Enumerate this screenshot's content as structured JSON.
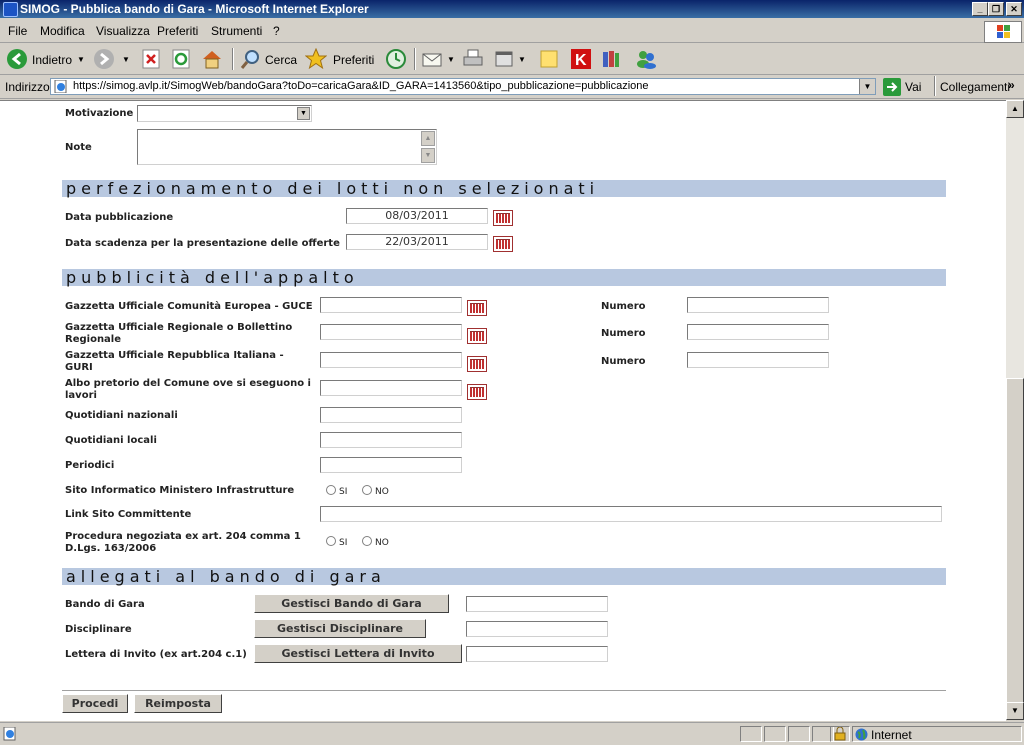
{
  "window": {
    "title": "SIMOG - Pubblica bando di Gara - Microsoft Internet Explorer"
  },
  "menu": {
    "file": "File",
    "modifica": "Modifica",
    "visualizza": "Visualizza",
    "preferiti": "Preferiti",
    "strumenti": "Strumenti",
    "help": "?"
  },
  "toolbar": {
    "back_label": "Indietro",
    "search_label": "Cerca",
    "favorites_label": "Preferiti"
  },
  "address": {
    "label": "Indirizzo",
    "url": "https://simog.avlp.it/SimogWeb/bandoGara?toDo=caricaGara&ID_GARA=1413560&tipo_pubblicazione=pubblicazione",
    "go_label": "Vai",
    "links_label": "Collegamenti"
  },
  "form": {
    "motivazione_label": "Motivazione",
    "note_label": "Note",
    "section1": "perfezionamento dei lotti non selezionati",
    "data_pubblicazione_label": "Data pubblicazione",
    "data_pubblicazione_value": "08/03/2011",
    "data_scadenza_label": "Data scadenza per la presentazione delle offerte",
    "data_scadenza_value": "22/03/2011",
    "section2": "pubblicità dell'appalto",
    "guce_label": "Gazzetta Ufficiale Comunità Europea - GUCE",
    "gur_label": "Gazzetta Ufficiale Regionale o Bollettino Regionale",
    "guri_label": "Gazzetta Ufficiale Repubblica Italiana - GURI",
    "albo_label": "Albo pretorio del Comune ove si eseguono i lavori",
    "numero_label": "Numero",
    "quotidiani_nazionali_label": "Quotidiani nazionali",
    "quotidiani_locali_label": "Quotidiani locali",
    "periodici_label": "Periodici",
    "sito_label": "Sito Informatico Ministero Infrastrutture",
    "si_label": "SI",
    "no_label": "NO",
    "link_label": "Link Sito Committente",
    "procedura_label": "Procedura negoziata ex art. 204 comma 1 D.Lgs. 163/2006",
    "section3": "allegati al bando di gara",
    "bando_label": "Bando di Gara",
    "bando_button": "Gestisci Bando di Gara",
    "disciplinare_label": "Disciplinare",
    "disciplinare_button": "Gestisci Disciplinare",
    "lettera_label": "Lettera di Invito (ex art.204 c.1)",
    "lettera_button": "Gestisci Lettera di Invito",
    "procedi_button": "Procedi",
    "reimposta_button": "Reimposta"
  },
  "status": {
    "zone": "Internet"
  }
}
